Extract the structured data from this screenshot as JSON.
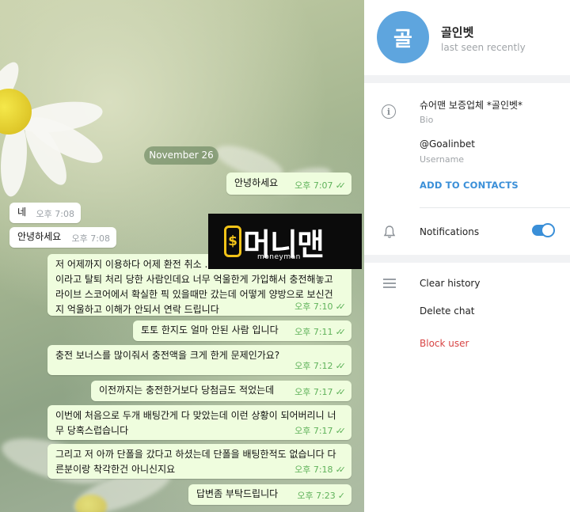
{
  "chat": {
    "date": "November 26",
    "messages": [
      {
        "dir": "out",
        "text": "안녕하세요",
        "time": "오후 7:07"
      },
      {
        "dir": "in",
        "text": "네",
        "time": "오후 7:08"
      },
      {
        "dir": "in",
        "text": "안녕하세요",
        "time": "오후 7:08"
      },
      {
        "dir": "out",
        "text": "저 어제까지 이용하다 어제 환전 취소 ...\n이라고 탈퇴 처리 당한 사람인데요 너무 억울한게 가입해서 충전해놓고\n라이브 스코어에서 확실한 픽 있을때만 갔는데 어떻게 양방으로 보신건\n지 억울하고 이해가 안되서 연락 드립니다",
        "time": "오후 7:10"
      },
      {
        "dir": "out",
        "text": "토토 한지도 얼마 안된 사람 입니다",
        "time": "오후 7:11"
      },
      {
        "dir": "out",
        "text": "충전 보너스를 많이줘서 충전액을 크게 한게 문제인가요?",
        "time": "오후 7:12"
      },
      {
        "dir": "out",
        "text": "이전까지는 충전한거보다 당첨금도 적었는데",
        "time": "오후 7:17"
      },
      {
        "dir": "out",
        "text": "이번에 처음으로 두개 배팅간게 다 맞았는데 이런 상황이 되어버리니 너\n무 당혹스럽습니다",
        "time": "오후 7:17"
      },
      {
        "dir": "out",
        "text": "그리고 저 아까 단폴을 갔다고 하셨는데 단폴을 배팅한적도 없습니다 다\n른분이랑 착각한건 아니신지요",
        "time": "오후 7:18"
      },
      {
        "dir": "out",
        "text": "답변좀 부탁드립니다",
        "time": "오후 7:23"
      }
    ]
  },
  "watermark": {
    "logo_text": "머니맨",
    "coin_symbol": "$",
    "sub": "moneyman"
  },
  "profile": {
    "avatar_text": "골",
    "name": "골인벳",
    "status": "last seen recently",
    "bio": "슈어맨 보증업체 *골인벳*",
    "bio_label": "Bio",
    "username": "@Goalinbet",
    "username_label": "Username",
    "add_contacts": "ADD TO CONTACTS",
    "notifications": "Notifications",
    "notifications_on": true,
    "clear_history": "Clear history",
    "delete_chat": "Delete chat",
    "block_user": "Block user"
  },
  "colors": {
    "accent": "#3a8fd8",
    "bubble_out": "#effdde",
    "danger": "#d84545",
    "avatar": "#5ea5de"
  }
}
